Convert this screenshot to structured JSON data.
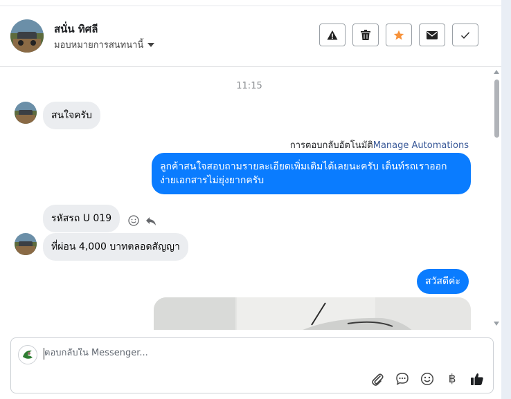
{
  "header": {
    "contact_name": "สนั่น ทิศลี",
    "assign_label": "มอบหมายการสนทนานี้",
    "actions": [
      {
        "name": "spam-button",
        "icon": "warning-icon"
      },
      {
        "name": "delete-button",
        "icon": "trash-icon"
      },
      {
        "name": "star-button",
        "icon": "star-icon",
        "color": "#f7923b"
      },
      {
        "name": "mark-unread-button",
        "icon": "envelope-icon"
      },
      {
        "name": "mark-done-button",
        "icon": "check-icon"
      }
    ]
  },
  "thread": {
    "timestamp": "11:15",
    "messages": [
      {
        "direction": "incoming",
        "text": "สนใจครับ"
      },
      {
        "direction": "outgoing",
        "text": "ลูกค้าสนใจสอบถามรายละเอียดเพิ่มเติมได้เลยนะครับ เต็นท์รถเราออกง่ายเอกสารไม่ยุ่งยากครับ"
      },
      {
        "direction": "incoming",
        "text": "รหัสรถ U 019"
      },
      {
        "direction": "incoming",
        "text": "ที่ผ่อน 4,000 บาทตลอดสัญญา"
      },
      {
        "direction": "outgoing",
        "text": "สวัสดีค่ะ"
      }
    ],
    "automation_label": "การตอบกลับอัตโนมัติ",
    "automation_link": "Manage Automations"
  },
  "composer": {
    "placeholder": "ตอบกลับใน Messenger...",
    "value": "",
    "baht_symbol": "฿"
  },
  "colors": {
    "outgoing_bubble": "#0a7cff",
    "incoming_bubble": "#ebedf0",
    "accent_star": "#f7923b"
  }
}
